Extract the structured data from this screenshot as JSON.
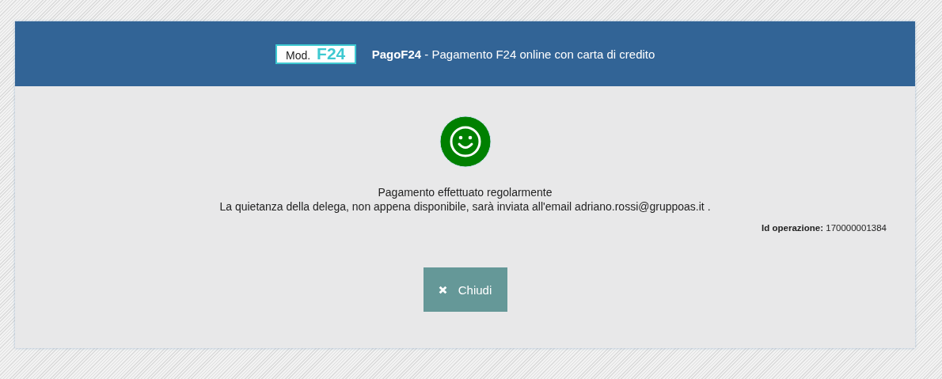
{
  "header": {
    "logo": {
      "prefix": "Mod.",
      "code": "F24"
    },
    "brand": "PagoF24",
    "title": " - Pagamento F24 online con carta di credito"
  },
  "result": {
    "success": true,
    "message": "Pagamento effettuato regolarmente",
    "detail": "La quietanza della delega, non appena disponibile, sarà inviata all'email adriano.rossi@gruppoas.it ."
  },
  "operation": {
    "label": "Id operazione:",
    "value": "170000001384"
  },
  "buttons": [
    {
      "label": "Chiudi"
    }
  ]
}
